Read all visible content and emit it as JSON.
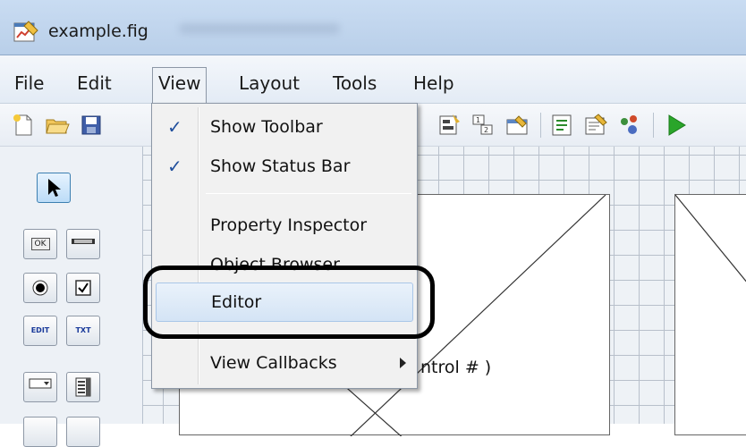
{
  "window": {
    "title": "example.fig",
    "app_icon": "figure-window-icon"
  },
  "menubar": {
    "items": [
      {
        "label": "File"
      },
      {
        "label": "Edit"
      },
      {
        "label": "View"
      },
      {
        "label": "Layout"
      },
      {
        "label": "Tools"
      },
      {
        "label": "Help"
      }
    ],
    "open_menu": "View"
  },
  "toolbar": {
    "left_icons": [
      "new-file-icon",
      "open-folder-icon",
      "save-icon"
    ],
    "right_icons": [
      "align-objects-icon",
      "tab-order-icon",
      "menu-editor-icon",
      "m-file-editor-icon",
      "property-inspector-icon",
      "object-browser-icon",
      "run-figure-icon"
    ],
    "run_color": "#2aa52a"
  },
  "palette": {
    "tools": [
      {
        "name": "select-arrow-tool",
        "text": ""
      },
      {
        "name": "push-button-tool",
        "text": "OK"
      },
      {
        "name": "slider-tool",
        "text": ""
      },
      {
        "name": "radio-button-tool",
        "text": ""
      },
      {
        "name": "checkbox-tool",
        "text": ""
      },
      {
        "name": "edit-text-tool",
        "text": "EDIT"
      },
      {
        "name": "static-text-tool",
        "text": "TXT"
      },
      {
        "name": "popup-menu-tool",
        "text": ""
      },
      {
        "name": "listbox-tool",
        "text": ""
      }
    ]
  },
  "canvas": {
    "partial_text": "ntrol # )"
  },
  "view_menu": {
    "items": [
      {
        "label": "Show Toolbar",
        "checked": true
      },
      {
        "label": "Show Status Bar",
        "checked": true
      },
      {
        "label": "Property Inspector",
        "checked": false
      },
      {
        "label": "Object Browser",
        "checked": false
      },
      {
        "label": "Editor",
        "checked": false,
        "highlighted": true
      },
      {
        "label": "View Callbacks",
        "checked": false,
        "submenu": true
      }
    ],
    "check_glyph": "✓"
  },
  "colors": {
    "highlight": "#d4e4f5",
    "annotation": "#000000"
  }
}
